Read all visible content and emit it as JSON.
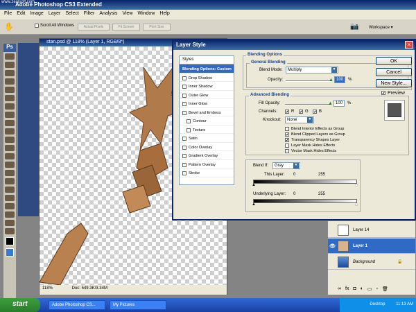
{
  "watermark": "www.zealsoft.com",
  "app": {
    "title": "Adobe Photoshop CS3 Extended",
    "menu": [
      "File",
      "Edit",
      "Image",
      "Layer",
      "Select",
      "Filter",
      "Analysis",
      "View",
      "Window",
      "Help"
    ],
    "options": {
      "scroll_all_windows": "Scroll All Windows",
      "actual_pixels": "Actual Pixels",
      "fit_screen": "Fit Screen",
      "print_size": "Print Size",
      "workspace": "Workspace ▾"
    },
    "logo": "Ps"
  },
  "document": {
    "title": "stan.psd @ 118% (Layer 1, RGB/8*)",
    "zoom": "118%",
    "doc_info": "Doc: 549.3K/3.34M"
  },
  "dialog": {
    "title": "Layer Style",
    "styles_header": "Styles",
    "styles": [
      {
        "label": "Blending Options: Custom",
        "selected": true,
        "checkbox": false,
        "sub": false
      },
      {
        "label": "Drop Shadow",
        "checkbox": true,
        "sub": false
      },
      {
        "label": "Inner Shadow",
        "checkbox": true,
        "sub": false
      },
      {
        "label": "Outer Glow",
        "checkbox": true,
        "sub": false
      },
      {
        "label": "Inner Glow",
        "checkbox": true,
        "sub": false
      },
      {
        "label": "Bevel and Emboss",
        "checkbox": true,
        "sub": false
      },
      {
        "label": "Contour",
        "checkbox": true,
        "sub": true
      },
      {
        "label": "Texture",
        "checkbox": true,
        "sub": true
      },
      {
        "label": "Satin",
        "checkbox": true,
        "sub": false
      },
      {
        "label": "Color Overlay",
        "checkbox": true,
        "sub": false
      },
      {
        "label": "Gradient Overlay",
        "checkbox": true,
        "sub": false
      },
      {
        "label": "Pattern Overlay",
        "checkbox": true,
        "sub": false
      },
      {
        "label": "Stroke",
        "checkbox": true,
        "sub": false
      }
    ],
    "blending_options": "Blending Options",
    "general_blending": "General Blending",
    "blend_mode_label": "Blend Mode:",
    "blend_mode": "Multiply",
    "opacity_label": "Opacity:",
    "opacity": "100",
    "advanced_blending": "Advanced Blending",
    "fill_opacity_label": "Fill Opacity:",
    "fill_opacity": "100",
    "percent": "%",
    "channels_label": "Channels:",
    "channels": [
      "R",
      "G",
      "B"
    ],
    "knockout_label": "Knockout:",
    "knockout": "None",
    "advanced_checks": [
      {
        "label": "Blend Interior Effects as Group",
        "checked": false
      },
      {
        "label": "Blend Clipped Layers as Group",
        "checked": true
      },
      {
        "label": "Transparency Shapes Layer",
        "checked": true
      },
      {
        "label": "Layer Mask Hides Effects",
        "checked": false
      },
      {
        "label": "Vector Mask Hides Effects",
        "checked": false
      }
    ],
    "blend_if_label": "Blend If:",
    "blend_if": "Gray",
    "this_layer_label": "This Layer:",
    "underlying_layer_label": "Underlying Layer:",
    "range_min": "0",
    "range_max": "255",
    "ok": "OK",
    "cancel": "Cancel",
    "new_style": "New Style...",
    "preview": "Preview"
  },
  "layers": [
    {
      "name": "Layer 14",
      "selected": false,
      "italic": false
    },
    {
      "name": "Layer 1",
      "selected": true,
      "italic": false
    },
    {
      "name": "Background",
      "selected": false,
      "italic": true
    }
  ],
  "taskbar": {
    "start": "start",
    "items": [
      "Adobe Photoshop CS...",
      "My Pictures"
    ],
    "desktop": "Desktop",
    "time": "11:13 AM"
  },
  "colors": {
    "title_bar": "#0a246a",
    "selection": "#316ac5",
    "taskbar": "#245edb"
  }
}
